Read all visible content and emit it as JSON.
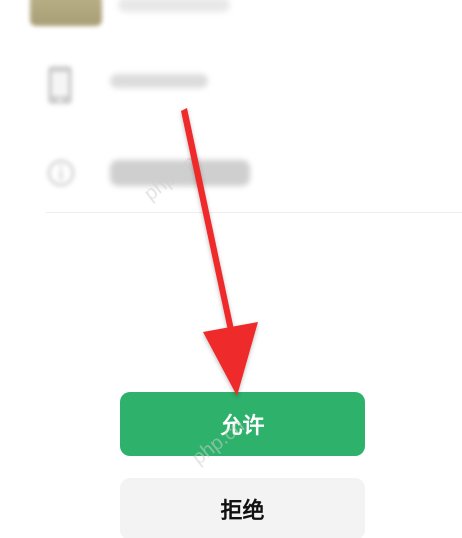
{
  "buttons": {
    "allow_label": "允许",
    "deny_label": "拒绝"
  },
  "watermark": "php.cn",
  "colors": {
    "allow_bg": "#2db16b",
    "deny_bg": "#f3f3f3",
    "arrow": "#ee2b2b"
  },
  "icons": {
    "row2": "phone-icon",
    "row3": "info-icon",
    "annotation": "red-arrow-annotation"
  }
}
